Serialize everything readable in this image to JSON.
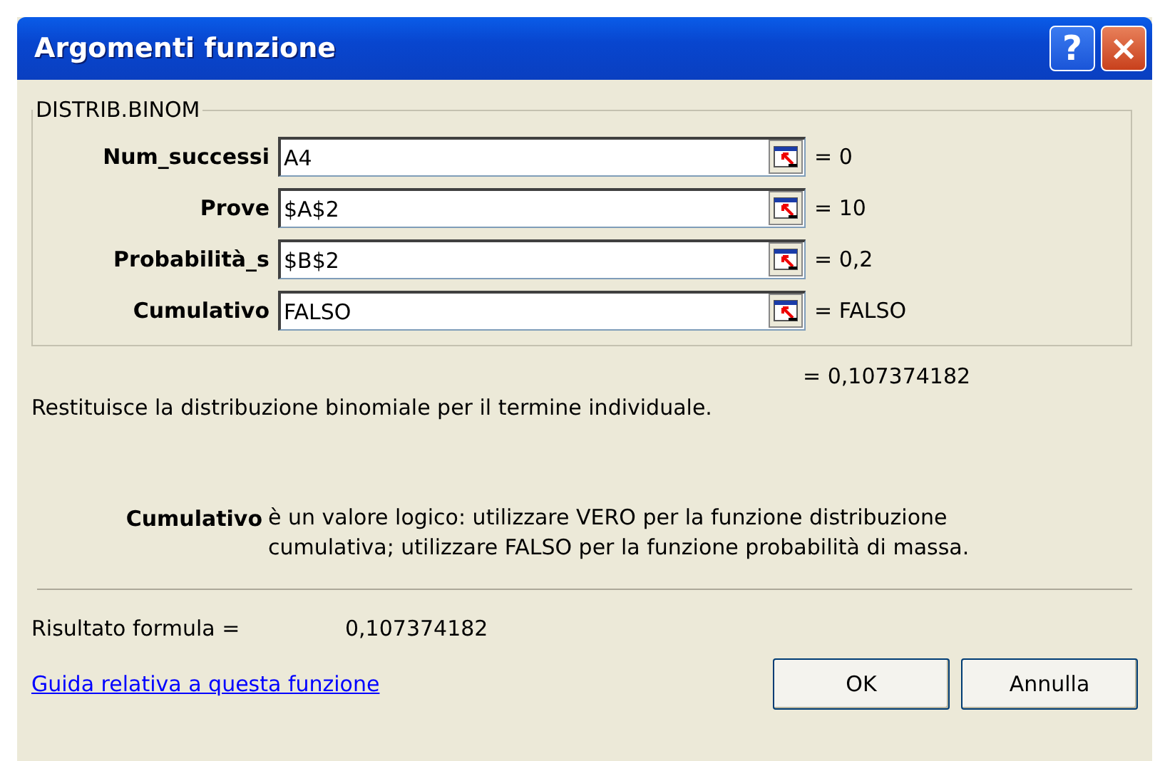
{
  "window": {
    "title": "Argomenti funzione",
    "buttons": [
      {
        "kind": "help",
        "label": "?"
      },
      {
        "kind": "close",
        "label": "×"
      }
    ]
  },
  "group": {
    "title": "DISTRIB.BINOM",
    "arguments": [
      {
        "label": "Num_successi",
        "value": "A4",
        "result": "= 0"
      },
      {
        "label": "Prove",
        "value": "$A$2",
        "result": "= 10"
      },
      {
        "label": "Probabilità_s",
        "value": "$B$2",
        "result": "= 0,2"
      },
      {
        "label": "Cumulativo",
        "value": "FALSO",
        "result": "= FALSO"
      }
    ]
  },
  "function_result": "= 0,107374182",
  "description": "Restituisce la distribuzione binomiale per il termine individuale.",
  "argument_help": {
    "name": "Cumulativo",
    "text": "è un valore logico: utilizzare VERO per la funzione distribuzione cumulativa; utilizzare FALSO per la funzione probabilità di massa."
  },
  "formula_result": {
    "label": "Risultato formula =",
    "value": "0,107374182"
  },
  "help_link": "Guida relativa a questa funzione",
  "buttons": [
    "OK",
    "Annulla"
  ]
}
